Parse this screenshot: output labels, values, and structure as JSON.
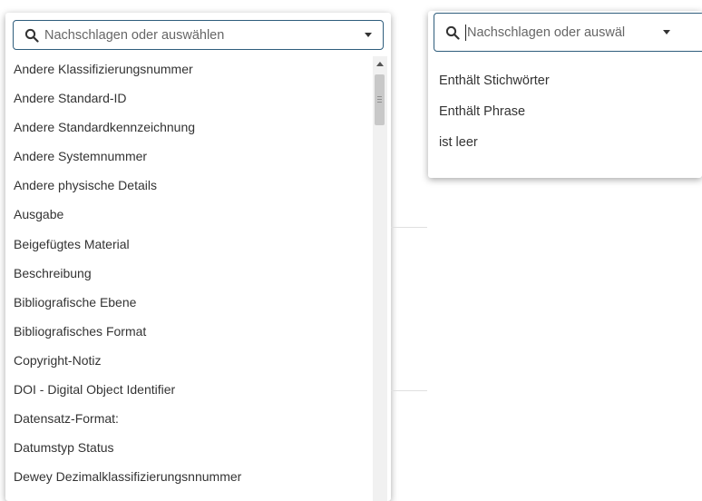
{
  "left_dropdown": {
    "search": {
      "placeholder": "Nachschlagen oder auswählen"
    },
    "items": [
      "Andere Klassifizierungsnummer",
      "Andere Standard-ID",
      "Andere Standardkennzeichnung",
      "Andere Systemnummer",
      "Andere physische Details",
      "Ausgabe",
      "Beigefügtes Material",
      "Beschreibung",
      "Bibliografische Ebene",
      "Bibliografisches Format",
      "Copyright-Notiz",
      "DOI - Digital Object Identifier",
      "Datensatz-Format:",
      "Datumstyp Status",
      "Dewey Dezimalklassifizierungsnnummer"
    ]
  },
  "right_dropdown": {
    "search": {
      "placeholder": "Nachschlagen oder auswäl"
    },
    "items": [
      "Enthält Stichwörter",
      "Enthält Phrase",
      "ist leer"
    ]
  },
  "colors": {
    "focus_border": "#2f5d7c",
    "text": "#333333"
  },
  "icons": {
    "search": "search-icon",
    "caret": "caret-down-icon"
  }
}
